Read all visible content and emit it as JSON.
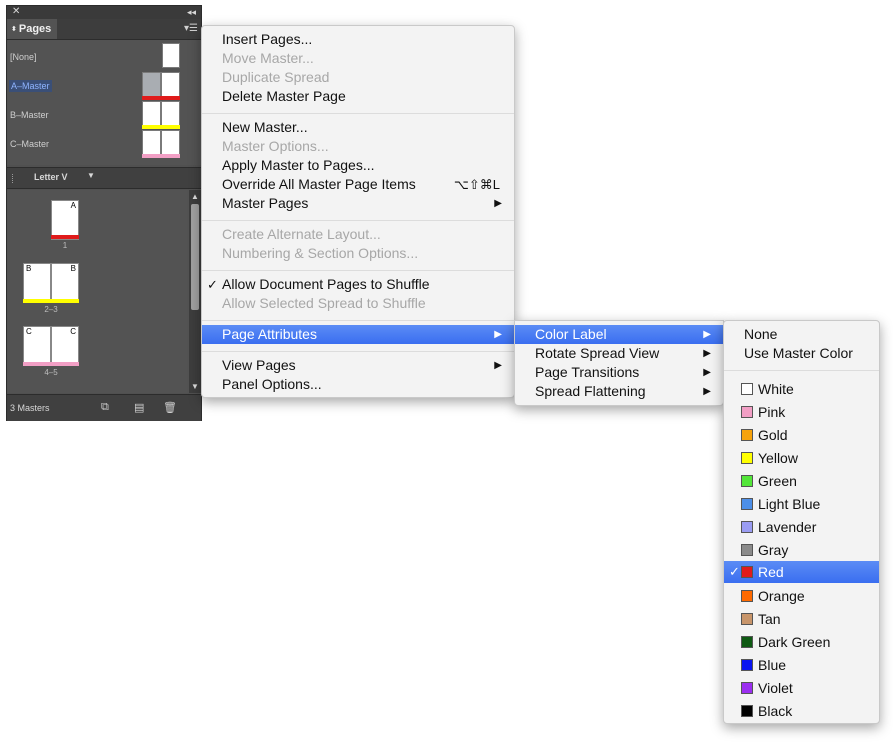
{
  "panel": {
    "title": "Pages",
    "masters": [
      {
        "name": "[None]",
        "label_color": ""
      },
      {
        "name": "A–Master",
        "label_color": "#e01b1b"
      },
      {
        "name": "B–Master",
        "label_color": "#ffff00"
      },
      {
        "name": "C–Master",
        "label_color": "#f29fc5"
      }
    ],
    "size_label": "Letter V",
    "pages": {
      "p1_letter": "A",
      "p1_num": "1",
      "p23_left": "B",
      "p23_right": "B",
      "p23_num": "2–3",
      "p45_left": "C",
      "p45_right": "C",
      "p45_num": "4–5"
    },
    "status": "3 Masters"
  },
  "main_menu": {
    "items": [
      {
        "label": "Insert Pages..."
      },
      {
        "label": "Move Master...",
        "disabled": true
      },
      {
        "label": "Duplicate Spread",
        "disabled": true
      },
      {
        "label": "Delete Master Page"
      },
      {
        "label": "New Master..."
      },
      {
        "label": "Master Options...",
        "disabled": true
      },
      {
        "label": "Apply Master to Pages..."
      },
      {
        "label": "Override All Master Page Items",
        "shortcut": "⌥⇧⌘L"
      },
      {
        "label": "Master Pages"
      },
      {
        "label": "Create Alternate Layout...",
        "disabled": true
      },
      {
        "label": "Numbering & Section Options...",
        "disabled": true
      },
      {
        "label": "Allow Document Pages to Shuffle",
        "checked": true
      },
      {
        "label": "Allow Selected Spread to Shuffle",
        "disabled": true
      },
      {
        "label": "Page Attributes",
        "highlighted": true
      },
      {
        "label": "View Pages"
      },
      {
        "label": "Panel Options..."
      }
    ]
  },
  "sub_menu": {
    "items": [
      {
        "label": "Color Label",
        "highlighted": true
      },
      {
        "label": "Rotate Spread View"
      },
      {
        "label": "Page Transitions"
      },
      {
        "label": "Spread Flattening"
      }
    ]
  },
  "color_menu": {
    "top": [
      {
        "label": "None"
      },
      {
        "label": "Use Master Color"
      }
    ],
    "colors": [
      {
        "label": "White",
        "color": "#ffffff"
      },
      {
        "label": "Pink",
        "color": "#f29fc5"
      },
      {
        "label": "Gold",
        "color": "#f7a30c"
      },
      {
        "label": "Yellow",
        "color": "#ffff00"
      },
      {
        "label": "Green",
        "color": "#53e639"
      },
      {
        "label": "Light Blue",
        "color": "#4d8fe8"
      },
      {
        "label": "Lavender",
        "color": "#9a9cf2"
      },
      {
        "label": "Gray",
        "color": "#8a8a8a"
      },
      {
        "label": "Red",
        "color": "#e01b1b",
        "checked": true
      },
      {
        "label": "Orange",
        "color": "#ff6a00"
      },
      {
        "label": "Tan",
        "color": "#c8956a"
      },
      {
        "label": "Dark Green",
        "color": "#0f5a13"
      },
      {
        "label": "Blue",
        "color": "#0a14f0"
      },
      {
        "label": "Violet",
        "color": "#9b2ff0"
      },
      {
        "label": "Black",
        "color": "#000000"
      }
    ]
  }
}
